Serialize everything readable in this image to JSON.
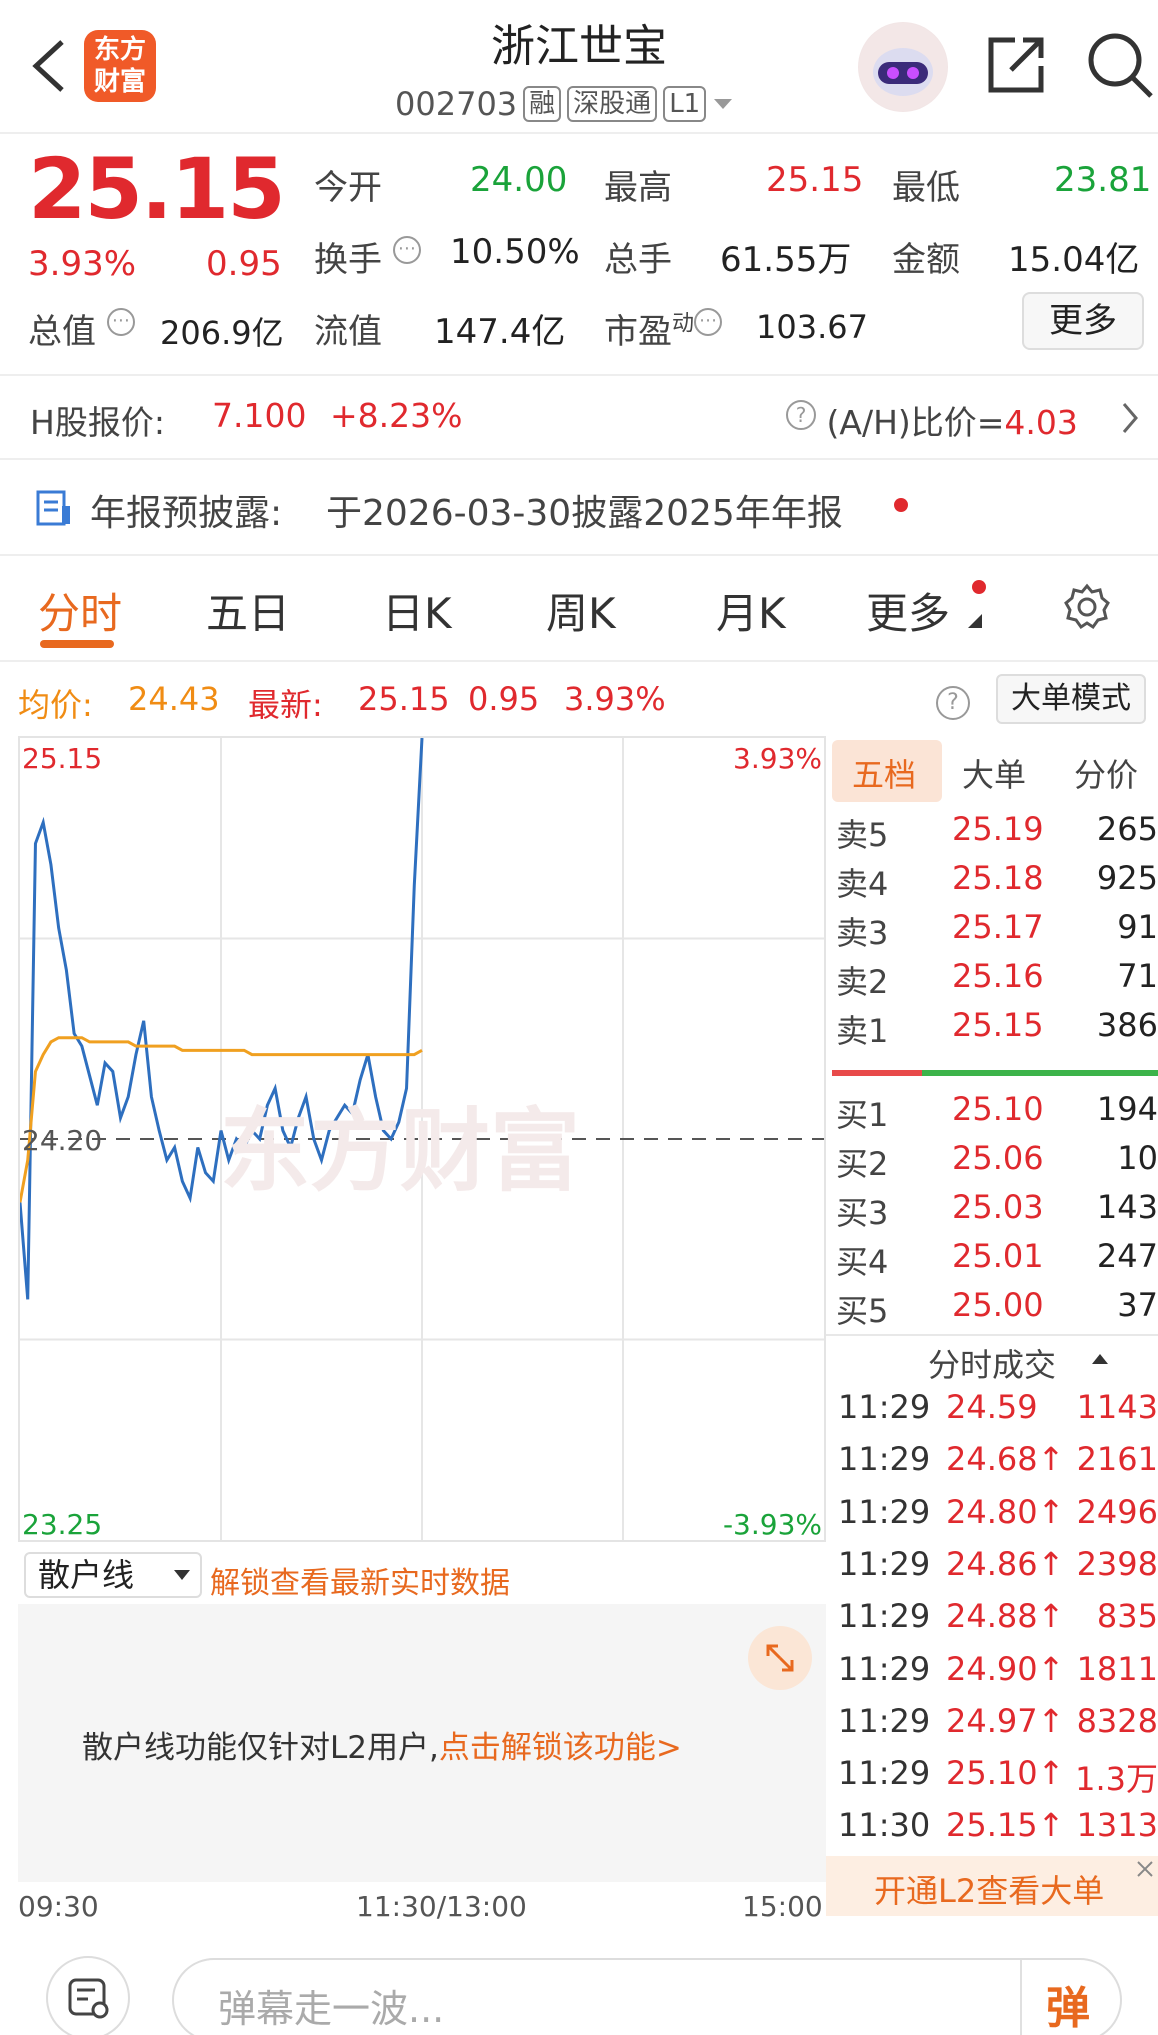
{
  "header": {
    "logo_line1": "东方",
    "logo_line2": "财富",
    "stock_name": "浙江世宝",
    "code": "002703",
    "tags": [
      "融",
      "深股通",
      "L1"
    ]
  },
  "quote": {
    "price": "25.15",
    "change_pct": "3.93%",
    "change": "0.95",
    "open_label": "今开",
    "open": "24.00",
    "high_label": "最高",
    "high": "25.15",
    "low_label": "最低",
    "low": "23.81",
    "turnover_label": "换手",
    "turnover": "10.50%",
    "volume_label": "总手",
    "volume": "61.55万",
    "amount_label": "金额",
    "amount": "15.04亿",
    "mktcap_label": "总值",
    "mktcap": "206.9亿",
    "float_label": "流值",
    "float": "147.4亿",
    "pe_label": "市盈",
    "pe_sup": "动",
    "pe": "103.67",
    "more_label": "更多"
  },
  "hshare": {
    "label": "H股报价:",
    "price": "7.100",
    "change": "+8.23%",
    "ah_label": "(A/H)比价=",
    "ah_value": "4.03"
  },
  "notice": {
    "label": "年报预披露:",
    "text": "于2026-03-30披露2025年年报"
  },
  "tabs": [
    "分时",
    "五日",
    "日K",
    "周K",
    "月K",
    "更多"
  ],
  "chart_header": {
    "avg_label": "均价:",
    "avg": "24.43",
    "latest_label": "最新:",
    "latest": "25.15",
    "change": "0.95",
    "change_pct": "3.93%",
    "mode_button": "大单模式"
  },
  "chart_data": {
    "type": "line",
    "y_top": "25.15",
    "y_mid": "24.20",
    "y_bottom": "23.25",
    "pct_top": "3.93%",
    "pct_bottom": "-3.93%",
    "ylim": [
      23.25,
      25.15
    ],
    "prev_close": 24.2,
    "x_ticks": [
      "09:30",
      "11:30/13:00",
      "15:00"
    ],
    "watermark": "东方财富",
    "series": [
      {
        "name": "price",
        "color": "#2e6fbf",
        "values": [
          24.05,
          23.82,
          24.9,
          24.95,
          24.85,
          24.7,
          24.6,
          24.45,
          24.42,
          24.35,
          24.28,
          24.38,
          24.36,
          24.25,
          24.3,
          24.4,
          24.48,
          24.3,
          24.22,
          24.15,
          24.18,
          24.1,
          24.06,
          24.18,
          24.12,
          24.1,
          24.22,
          24.15,
          24.2,
          24.18,
          24.22,
          24.2,
          24.28,
          24.32,
          24.22,
          24.18,
          24.25,
          24.3,
          24.2,
          24.15,
          24.22,
          24.25,
          24.28,
          24.26,
          24.34,
          24.4,
          24.3,
          24.22,
          24.2,
          24.24,
          24.32,
          24.8,
          25.15
        ]
      },
      {
        "name": "avg",
        "color": "#f0a020",
        "values": [
          24.05,
          24.15,
          24.36,
          24.4,
          24.43,
          24.44,
          24.44,
          24.44,
          24.44,
          24.43,
          24.43,
          24.43,
          24.43,
          24.43,
          24.43,
          24.42,
          24.42,
          24.42,
          24.42,
          24.42,
          24.42,
          24.41,
          24.41,
          24.41,
          24.41,
          24.41,
          24.41,
          24.41,
          24.41,
          24.41,
          24.4,
          24.4,
          24.4,
          24.4,
          24.4,
          24.4,
          24.4,
          24.4,
          24.4,
          24.4,
          24.4,
          24.4,
          24.4,
          24.4,
          24.4,
          24.4,
          24.4,
          24.4,
          24.4,
          24.4,
          24.4,
          24.4,
          24.41
        ]
      }
    ]
  },
  "sub_panel": {
    "dropdown": "散户线",
    "unlock_text": "解锁查看最新实时数据",
    "body_text": "散户线功能仅针对L2用户,",
    "body_link": "点击解锁该功能>"
  },
  "orderbook": {
    "tabs": [
      "五档",
      "大单",
      "分价"
    ],
    "asks": [
      {
        "label": "卖5",
        "price": "25.19",
        "vol": "265"
      },
      {
        "label": "卖4",
        "price": "25.18",
        "vol": "925"
      },
      {
        "label": "卖3",
        "price": "25.17",
        "vol": "91"
      },
      {
        "label": "卖2",
        "price": "25.16",
        "vol": "71"
      },
      {
        "label": "卖1",
        "price": "25.15",
        "vol": "386"
      }
    ],
    "bids": [
      {
        "label": "买1",
        "price": "25.10",
        "vol": "194"
      },
      {
        "label": "买2",
        "price": "25.06",
        "vol": "10"
      },
      {
        "label": "买3",
        "price": "25.03",
        "vol": "143"
      },
      {
        "label": "买4",
        "price": "25.01",
        "vol": "247"
      },
      {
        "label": "买5",
        "price": "25.00",
        "vol": "37"
      }
    ],
    "trades_title": "分时成交",
    "trades": [
      {
        "time": "11:29",
        "price": "24.59",
        "vol": "1143"
      },
      {
        "time": "11:29",
        "price": "24.68↑",
        "vol": "2161"
      },
      {
        "time": "11:29",
        "price": "24.80↑",
        "vol": "2496"
      },
      {
        "time": "11:29",
        "price": "24.86↑",
        "vol": "2398"
      },
      {
        "time": "11:29",
        "price": "24.88↑",
        "vol": "835"
      },
      {
        "time": "11:29",
        "price": "24.90↑",
        "vol": "1811"
      },
      {
        "time": "11:29",
        "price": "24.97↑",
        "vol": "8328"
      },
      {
        "time": "11:29",
        "price": "25.10↑",
        "vol": "1.3万"
      },
      {
        "time": "11:30",
        "price": "25.15↑",
        "vol": "1313"
      }
    ],
    "l2_banner": "开通L2查看大单"
  },
  "bottom": {
    "placeholder": "弹幕走一波...",
    "danmu_button": "弹"
  }
}
